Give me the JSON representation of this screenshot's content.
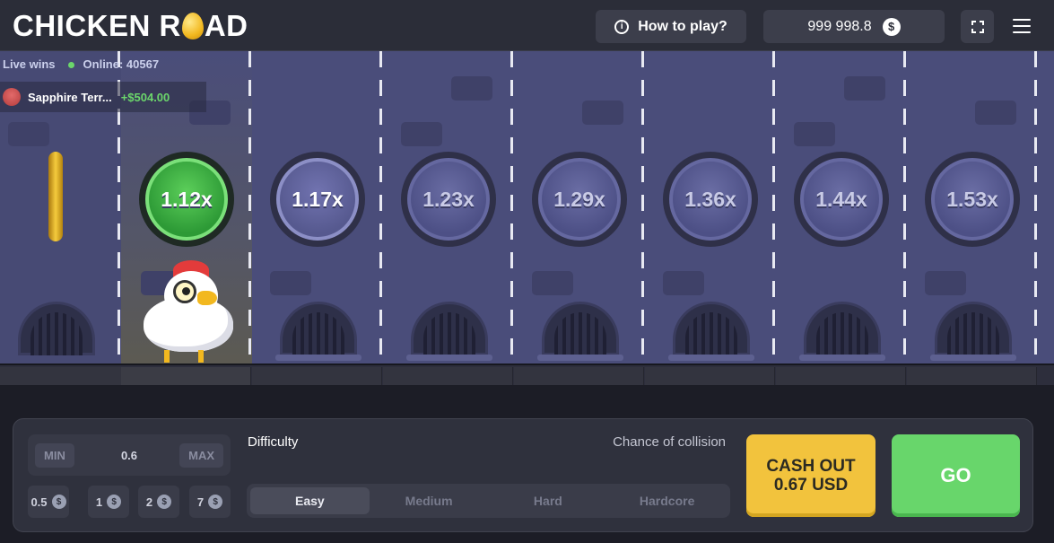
{
  "header": {
    "logo_left": "CHICKEN R",
    "logo_right": "AD",
    "how_to_play": "How to play?",
    "info_icon": "i",
    "balance": "999 998.8",
    "currency_icon": "$"
  },
  "live": {
    "label": "Live wins",
    "online": "Online: 40567",
    "winner_name": "Sapphire Terr...",
    "winner_amount": "+$504.00"
  },
  "lanes": [
    {
      "multiplier": "1.12x",
      "state": "passed"
    },
    {
      "multiplier": "1.17x",
      "state": "active"
    },
    {
      "multiplier": "1.23x",
      "state": "upcoming"
    },
    {
      "multiplier": "1.29x",
      "state": "upcoming"
    },
    {
      "multiplier": "1.36x",
      "state": "upcoming"
    },
    {
      "multiplier": "1.44x",
      "state": "upcoming"
    },
    {
      "multiplier": "1.53x",
      "state": "upcoming"
    }
  ],
  "controls": {
    "min_label": "MIN",
    "max_label": "MAX",
    "bet_value": "0.6",
    "quick_bets": [
      "0.5",
      "1",
      "2",
      "7"
    ],
    "difficulty_label": "Difficulty",
    "chance_label": "Chance of collision",
    "difficulties": [
      "Easy",
      "Medium",
      "Hard",
      "Hardcore"
    ],
    "selected_difficulty": "Easy",
    "cashout_line1": "CASH OUT",
    "cashout_line2": "0.67 USD",
    "go_label": "GO"
  },
  "colors": {
    "accent_green": "#68d66b",
    "cashout_yellow": "#f2c33d",
    "road": "#4a4d7a"
  }
}
